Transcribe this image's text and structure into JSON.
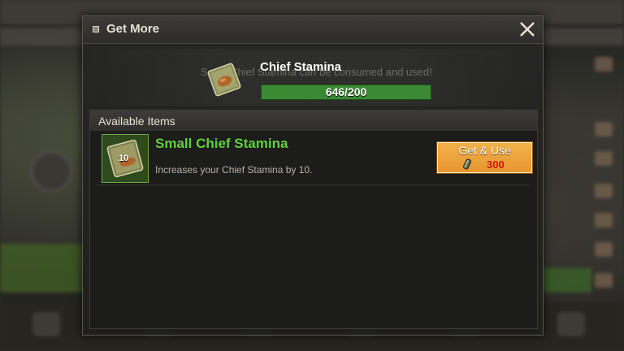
{
  "dialog": {
    "title": "Get More",
    "hero": {
      "title": "Chief Stamina",
      "ghost_text": "Small Chief Stamina can be consumed and used!",
      "progress_text": "646/200",
      "progress_fraction": 1.0
    },
    "available_items": {
      "header": "Available Items",
      "items": [
        {
          "name": "Small Chief Stamina",
          "count": "10",
          "description": "Increases your Chief Stamina by 10.",
          "button_label": "Get & Use",
          "cost": "300"
        }
      ]
    }
  },
  "colors": {
    "item_name": "#5fd03f",
    "progress_bar": "#2f7b2a",
    "button": "#f1b14a",
    "cost": "#c81c0c"
  },
  "icons": [
    "close-icon",
    "stamina-scroll-icon",
    "gem-icon"
  ]
}
